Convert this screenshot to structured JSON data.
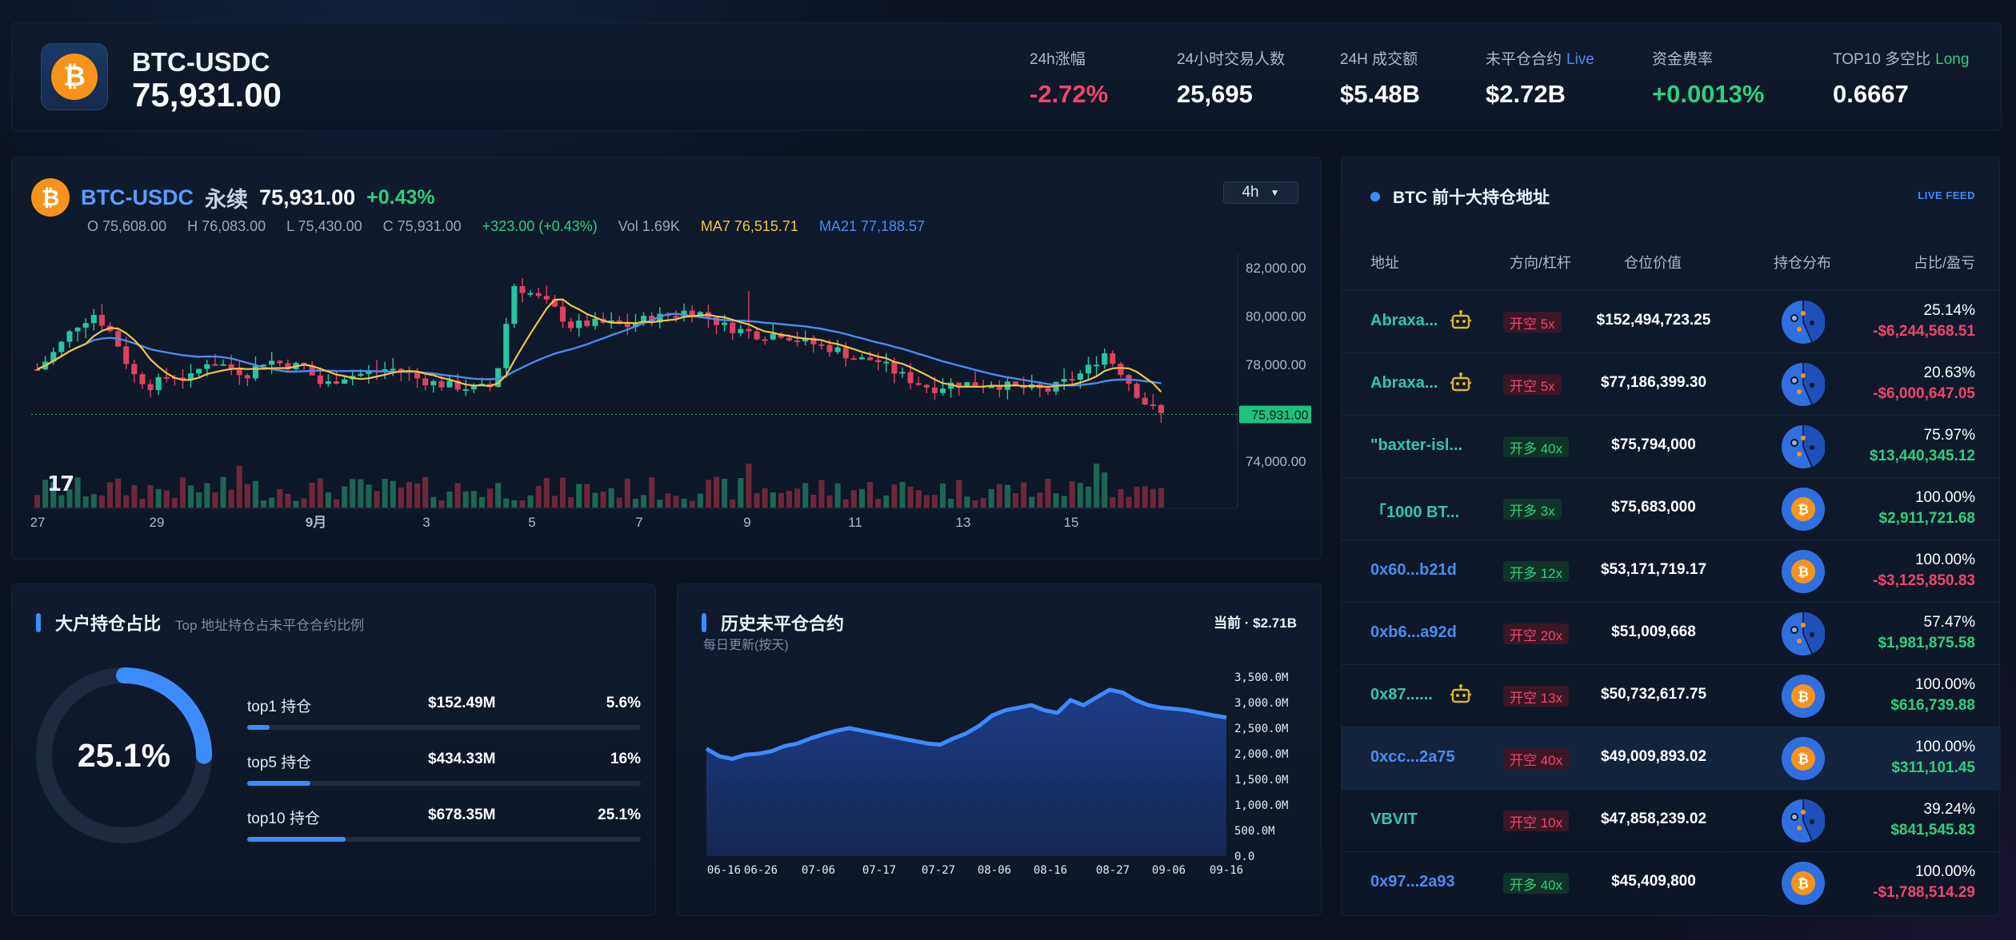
{
  "header": {
    "symbol": "BTC-USDC",
    "price": "75,931.00",
    "stats": [
      {
        "label": "24h涨幅",
        "tag": "",
        "value": "-2.72%",
        "tone": "neg"
      },
      {
        "label": "24小时交易人数",
        "tag": "",
        "value": "25,695",
        "tone": ""
      },
      {
        "label": "24H 成交额",
        "tag": "",
        "value": "$5.48B",
        "tone": ""
      },
      {
        "label": "未平仓合约",
        "tag": "Live",
        "value": "$2.72B",
        "tone": ""
      },
      {
        "label": "资金费率",
        "tag": "",
        "value": "+0.0013%",
        "tone": "pos"
      },
      {
        "label": "TOP10 多空比",
        "tag": "Long",
        "value": "0.6667",
        "tone": ""
      }
    ],
    "colors": {
      "live_tag": "#4a8cf0",
      "long_tag": "#2fd07a"
    }
  },
  "chart": {
    "symbol": "BTC-USDC",
    "type": "永续",
    "price": "75,931.00",
    "change": "+0.43%",
    "ohlc": {
      "open": "O 75,608.00",
      "high": "H 76,083.00",
      "low": "L 75,430.00",
      "close": "C 75,931.00",
      "diff": "+323.00 (+0.43%)",
      "vol": "Vol 1.69K",
      "ma7": "MA7 76,515.71",
      "ma21": "MA21 77,188.57"
    },
    "timeframe": "4h",
    "last_price_label": "75,931.00",
    "tv_logo": "17",
    "y_ticks": [
      "82,000.00",
      "80,000.00",
      "78,000.00",
      "74,000.00"
    ],
    "x_ticks": [
      "27",
      "29",
      "9月",
      "3",
      "5",
      "7",
      "9",
      "11",
      "13",
      "15"
    ]
  },
  "chart_data": [
    {
      "type": "candlestick",
      "title": "BTC-USDC 永续",
      "interval": "4h",
      "ylim": [
        73000,
        82600
      ],
      "x_ticks": [
        "27",
        "29",
        "9月",
        "3",
        "5",
        "7",
        "9",
        "11",
        "13",
        "15"
      ],
      "close_series_approx": [
        77800,
        78600,
        79600,
        80100,
        79200,
        77600,
        77100,
        77600,
        77400,
        78200,
        77900,
        77600,
        78200,
        78000,
        77900,
        77100,
        77500,
        77600,
        77800,
        77800,
        77400,
        77200,
        77100,
        77000,
        77100,
        81300,
        80900,
        80400,
        79600,
        79700,
        79700,
        79600,
        79900,
        80000,
        80200,
        80100,
        79600,
        79400,
        79200,
        79300,
        79000,
        78800,
        78600,
        78200,
        78200,
        77700,
        77300,
        77000,
        77200,
        77200,
        77200,
        77100,
        77000,
        76900,
        77300,
        77700,
        78500,
        77600,
        76500,
        75931
      ],
      "ma7_label": "MA7 76,515.71",
      "ma21_label": "MA21 77,188.57",
      "last_price": 75931
    },
    {
      "type": "area",
      "title": "历史未平仓合约",
      "x_ticks": [
        "06-16",
        "06-26",
        "07-06",
        "07-17",
        "07-27",
        "08-06",
        "08-16",
        "08-27",
        "09-06",
        "09-16"
      ],
      "y_ticks": [
        "3,500.0M",
        "3,000.0M",
        "2,500.0M",
        "2,000.0M",
        "1,500.0M",
        "1,000.0M",
        "500.0M",
        "0.0"
      ],
      "ylim": [
        0,
        3500
      ],
      "unit": "M",
      "values": [
        2100,
        1950,
        1900,
        1980,
        2000,
        2050,
        2150,
        2200,
        2300,
        2380,
        2450,
        2500,
        2450,
        2400,
        2350,
        2300,
        2250,
        2200,
        2180,
        2300,
        2400,
        2550,
        2750,
        2850,
        2900,
        2950,
        2850,
        2800,
        3050,
        2950,
        3100,
        3250,
        3200,
        3050,
        2950,
        2900,
        2880,
        2850,
        2800,
        2750,
        2710
      ],
      "current": "当前 · $2.71B"
    },
    {
      "type": "pie",
      "title": "大户持仓占比",
      "values": [
        25.1,
        74.9
      ],
      "labels": [
        "top10 持仓",
        ""
      ]
    }
  ],
  "holdings": {
    "title": "大户持仓占比",
    "subtitle": "Top 地址持仓占未平仓合约比例",
    "center_pct": "25.1%",
    "ring_value": 0.251,
    "rows": [
      {
        "label": "top1 持仓",
        "value": "$152.49M",
        "pct": "5.6%",
        "fill": 0.056
      },
      {
        "label": "top5 持仓",
        "value": "$434.33M",
        "pct": "16%",
        "fill": 0.16
      },
      {
        "label": "top10 持仓",
        "value": "$678.35M",
        "pct": "25.1%",
        "fill": 0.251
      }
    ]
  },
  "oi": {
    "title": "历史未平仓合约",
    "subtitle": "每日更新(按天)",
    "current": "当前 · $2.71B"
  },
  "top10": {
    "title": "BTC 前十大持仓地址",
    "live": "LIVE FEED",
    "columns": [
      "地址",
      "方向/杠杆",
      "仓位价值",
      "持仓分布",
      "占比/盈亏"
    ],
    "rows": [
      {
        "addr": "Abraxa...",
        "addr_color": "teal",
        "robot": true,
        "dir": "开空 5x",
        "side": "short",
        "value": "$152,494,723.25",
        "dist": "multi",
        "share": "25.14%",
        "pnl": "-$6,244,568.51",
        "pnl_tone": "neg",
        "hl": false
      },
      {
        "addr": "Abraxa...",
        "addr_color": "teal",
        "robot": true,
        "dir": "开空 5x",
        "side": "short",
        "value": "$77,186,399.30",
        "dist": "multi",
        "share": "20.63%",
        "pnl": "-$6,000,647.05",
        "pnl_tone": "neg",
        "hl": false
      },
      {
        "addr": "\"baxter-isl...",
        "addr_color": "teal",
        "robot": false,
        "dir": "开多 40x",
        "side": "long",
        "value": "$75,794,000",
        "dist": "multi",
        "share": "75.97%",
        "pnl": "$13,440,345.12",
        "pnl_tone": "pos",
        "hl": false
      },
      {
        "addr": "「1000 BT...",
        "addr_color": "teal",
        "robot": false,
        "dir": "开多 3x",
        "side": "long",
        "value": "$75,683,000",
        "dist": "btc",
        "share": "100.00%",
        "pnl": "$2,911,721.68",
        "pnl_tone": "pos",
        "hl": false
      },
      {
        "addr": "0x60...b21d",
        "addr_color": "blue",
        "robot": false,
        "dir": "开多 12x",
        "side": "long",
        "value": "$53,171,719.17",
        "dist": "btc",
        "share": "100.00%",
        "pnl": "-$3,125,850.83",
        "pnl_tone": "neg",
        "hl": false
      },
      {
        "addr": "0xb6...a92d",
        "addr_color": "blue",
        "robot": false,
        "dir": "开空 20x",
        "side": "short",
        "value": "$51,009,668",
        "dist": "multi",
        "share": "57.47%",
        "pnl": "$1,981,875.58",
        "pnl_tone": "pos",
        "hl": false
      },
      {
        "addr": "0x87......",
        "addr_color": "teal",
        "robot": true,
        "dir": "开空 13x",
        "side": "short",
        "value": "$50,732,617.75",
        "dist": "btc",
        "share": "100.00%",
        "pnl": "$616,739.88",
        "pnl_tone": "pos",
        "hl": false
      },
      {
        "addr": "0xcc...2a75",
        "addr_color": "blue",
        "robot": false,
        "dir": "开空 40x",
        "side": "short",
        "value": "$49,009,893.02",
        "dist": "btc",
        "share": "100.00%",
        "pnl": "$311,101.45",
        "pnl_tone": "pos",
        "hl": true
      },
      {
        "addr": "VBVIT",
        "addr_color": "teal",
        "robot": false,
        "dir": "开空 10x",
        "side": "short",
        "value": "$47,858,239.02",
        "dist": "multi",
        "share": "39.24%",
        "pnl": "$841,545.83",
        "pnl_tone": "pos",
        "hl": false
      },
      {
        "addr": "0x97...2a93",
        "addr_color": "blue",
        "robot": false,
        "dir": "开多 40x",
        "side": "long",
        "value": "$45,409,800",
        "dist": "btc",
        "share": "100.00%",
        "pnl": "-$1,788,514.29",
        "pnl_tone": "neg",
        "hl": false
      }
    ]
  },
  "icons": {
    "btc": "bitcoin-icon",
    "robot": "robot-icon",
    "tradingview": "tradingview-logo",
    "chevron": "chevron-down-icon"
  },
  "colors": {
    "up": "#26c6a0",
    "down": "#e0415e",
    "ma7": "#f5c242",
    "ma21": "#4a8cf0",
    "accent": "#3d8bff",
    "btc_orange": "#f7931a"
  }
}
